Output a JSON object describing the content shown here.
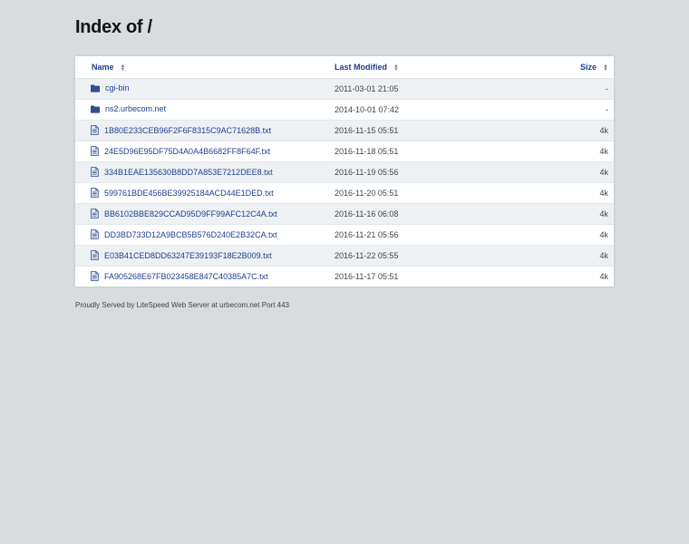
{
  "title": "Index of /",
  "columns": {
    "name": "Name",
    "last_modified": "Last Modified",
    "size": "Size",
    "sort_icon": "sort-icon"
  },
  "entries": [
    {
      "name": "cgi-bin",
      "modified": "2011-03-01 21:05",
      "size": "-",
      "type": "folder",
      "icon": "folder-icon"
    },
    {
      "name": "ns2.urbecom.net",
      "modified": "2014-10-01 07:42",
      "size": "-",
      "type": "folder",
      "icon": "folder-icon"
    },
    {
      "name": "1B80E233CEB96F2F6F8315C9AC71628B.txt",
      "modified": "2016-11-15 05:51",
      "size": "4k",
      "type": "file",
      "icon": "file-icon"
    },
    {
      "name": "24E5D96E95DF75D4A0A4B6682FF8F64F.txt",
      "modified": "2016-11-18 05:51",
      "size": "4k",
      "type": "file",
      "icon": "file-icon"
    },
    {
      "name": "334B1EAE135630B8DD7A853E7212DEE8.txt",
      "modified": "2016-11-19 05:56",
      "size": "4k",
      "type": "file",
      "icon": "file-icon"
    },
    {
      "name": "599761BDE456BE39925184ACD44E1DED.txt",
      "modified": "2016-11-20 05:51",
      "size": "4k",
      "type": "file",
      "icon": "file-icon"
    },
    {
      "name": "BB6102BBE829CCAD95D9FF99AFC12C4A.txt",
      "modified": "2016-11-16 06:08",
      "size": "4k",
      "type": "file",
      "icon": "file-icon"
    },
    {
      "name": "DD3BD733D12A9BCB5B576D240E2B32CA.txt",
      "modified": "2016-11-21 05:56",
      "size": "4k",
      "type": "file",
      "icon": "file-icon"
    },
    {
      "name": "E03B41CED8DD63247E39193F18E2B009.txt",
      "modified": "2016-11-22 05:55",
      "size": "4k",
      "type": "file",
      "icon": "file-icon"
    },
    {
      "name": "FA905268E67FB023458E847C40385A7C.txt",
      "modified": "2016-11-17 05:51",
      "size": "4k",
      "type": "file",
      "icon": "file-icon"
    }
  ],
  "footer": "Proudly Served by LiteSpeed Web Server at urbecom.net Port 443",
  "colors": {
    "background": "#d8dcdf",
    "link": "#1d3f8f",
    "row_alt": "#eef1f4",
    "icon": "#2f4f8f"
  }
}
